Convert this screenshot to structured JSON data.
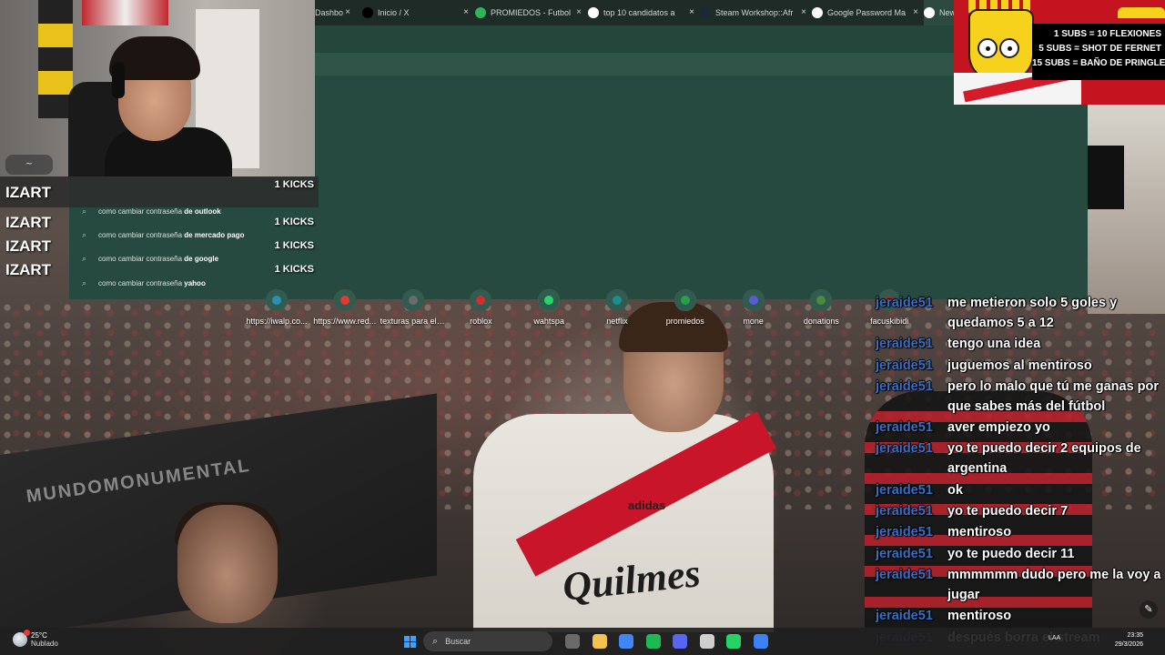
{
  "browser": {
    "tabs": [
      {
        "label": "Dashbo",
        "icon": "dashboard-icon",
        "color": "#6d9bd3"
      },
      {
        "label": "Inicio / X",
        "icon": "x-logo-icon",
        "color": "#000000"
      },
      {
        "label": "PROMIEDOS - Futbol",
        "icon": "promiedos-icon",
        "color": "#2fb45a"
      },
      {
        "label": "top 10 candidatos a",
        "icon": "google-icon",
        "color": "#ffffff"
      },
      {
        "label": "Steam Workshop::Afr",
        "icon": "steam-icon",
        "color": "#1b2838"
      },
      {
        "label": "Google Password Ma",
        "icon": "google-icon",
        "color": "#ffffff"
      },
      {
        "label": "New",
        "icon": "chrome-icon",
        "color": "#ffffff"
      }
    ],
    "tab_close_glyph": "×",
    "suggestions": [
      {
        "prefix": "como cambiar contraseña ",
        "bold": "de outlook"
      },
      {
        "prefix": "como cambiar contraseña ",
        "bold": "de mercado pago"
      },
      {
        "prefix": "como cambiar contraseña ",
        "bold": "de google"
      },
      {
        "prefix": "como cambiar contraseña ",
        "bold": "yahoo"
      }
    ],
    "shortcuts": [
      {
        "label": "https://iwalp.co...",
        "color": "#2a8fb0"
      },
      {
        "label": "https://www.red...",
        "color": "#e03b2f"
      },
      {
        "label": "texturas para el ...",
        "color": "#6a6a6a"
      },
      {
        "label": "roblox",
        "color": "#d42c2c"
      },
      {
        "label": "wahtspa",
        "color": "#25d366"
      },
      {
        "label": "netflix",
        "color": "#1a8f8f"
      },
      {
        "label": "promiedos",
        "color": "#27a04a"
      },
      {
        "label": "mone",
        "color": "#5b5bd6"
      },
      {
        "label": "donations",
        "color": "#4a8a3a"
      },
      {
        "label": "facuskibidi",
        "color": "#a82b2b"
      }
    ]
  },
  "kicks": [
    {
      "name": "IZART",
      "value": "1 KICKS"
    },
    {
      "name": "IZART",
      "value": "1 KICKS"
    },
    {
      "name": "IZART",
      "value": "1 KICKS"
    },
    {
      "name": "IZART",
      "value": "1 KICKS"
    }
  ],
  "subs_goals": [
    "1 SUBS = 10 FLEXIONES",
    "5 SUBS = SHOT DE FERNET",
    "15 SUBS = BAÑO DE PRINGLES"
  ],
  "wallpaper_text": {
    "watermark": "MUNDOMONUMENTAL",
    "sponsor": "Quilmes",
    "kit_brand": "adidas"
  },
  "chat": [
    {
      "user": "jeraide51",
      "text": "me metieron solo 5 goles y quedamos 5 a 12"
    },
    {
      "user": "jeraide51",
      "text": "tengo una idea"
    },
    {
      "user": "jeraide51",
      "text": "juguemos al mentiroso"
    },
    {
      "user": "jeraide51",
      "text": "pero lo malo que tú me ganas por que sabes más del fútbol"
    },
    {
      "user": "jeraide51",
      "text": "aver empiezo yo"
    },
    {
      "user": "jeraide51",
      "text": "yo te puedo decir 2 equipos de argentina"
    },
    {
      "user": "jeraide51",
      "text": "ok"
    },
    {
      "user": "jeraide51",
      "text": "yo te puedo decir 7"
    },
    {
      "user": "jeraide51",
      "text": "mentiroso"
    },
    {
      "user": "jeraide51",
      "text": "yo te puedo decir 11"
    },
    {
      "user": "jeraide51",
      "text": "mmmmmm dudo pero me la voy a jugar"
    },
    {
      "user": "jeraide51",
      "text": "mentiroso"
    },
    {
      "user": "jeraide51",
      "text": "después borra el stream"
    }
  ],
  "taskbar": {
    "weather_temp": "25°C",
    "weather_desc": "Nublado",
    "search_placeholder": "Buscar",
    "lang": "LAA",
    "time": "23:35",
    "date": "29/3/2026",
    "apps": [
      {
        "name": "task-view-icon",
        "color": "#6a6a6a"
      },
      {
        "name": "file-explorer-icon",
        "color": "#f2c14e"
      },
      {
        "name": "chrome-icon",
        "color": "#4285f4"
      },
      {
        "name": "spotify-icon",
        "color": "#1db954"
      },
      {
        "name": "discord-icon",
        "color": "#5865f2"
      },
      {
        "name": "app-icon",
        "color": "#cfcfcf"
      },
      {
        "name": "whatsapp-icon",
        "color": "#25d366"
      },
      {
        "name": "app2-icon",
        "color": "#3b82f6"
      }
    ]
  }
}
